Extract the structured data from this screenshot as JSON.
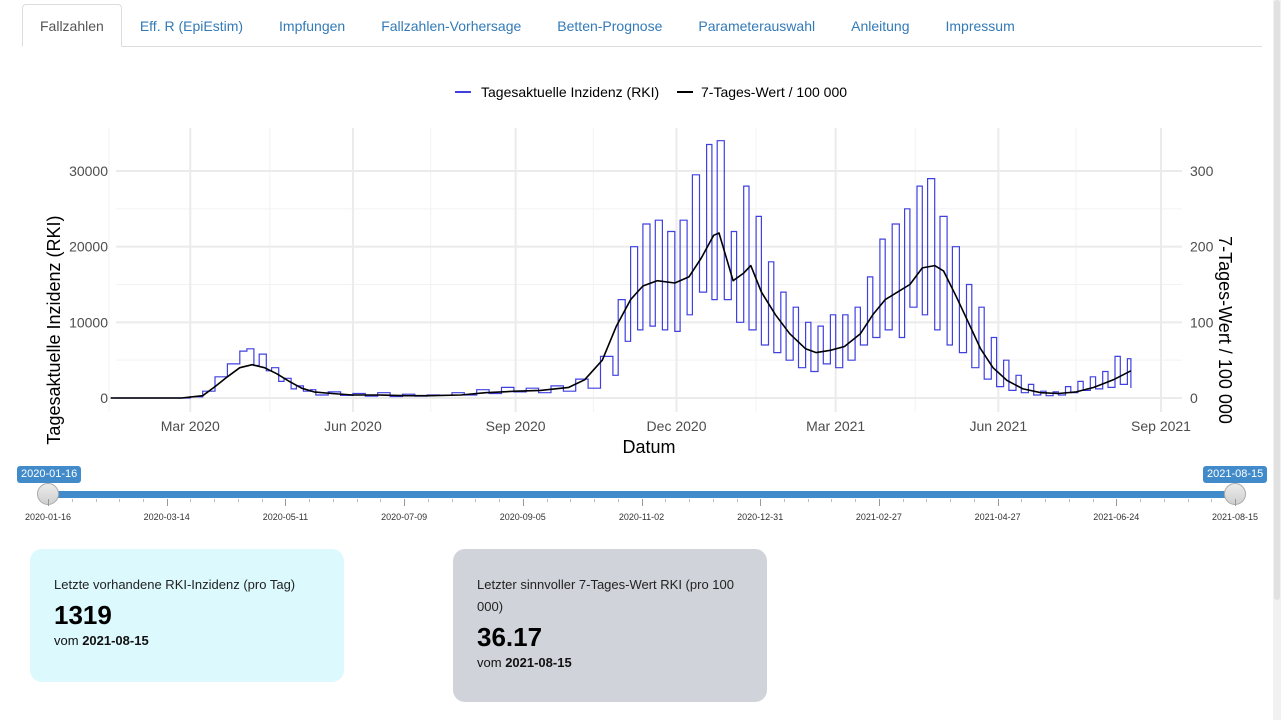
{
  "tabs": [
    {
      "label": "Fallzahlen",
      "active": true
    },
    {
      "label": "Eff. R (EpiEstim)",
      "active": false
    },
    {
      "label": "Impfungen",
      "active": false
    },
    {
      "label": "Fallzahlen-Vorhersage",
      "active": false
    },
    {
      "label": "Betten-Prognose",
      "active": false
    },
    {
      "label": "Parameterauswahl",
      "active": false
    },
    {
      "label": "Anleitung",
      "active": false
    },
    {
      "label": "Impressum",
      "active": false
    }
  ],
  "chart_data": {
    "type": "line",
    "xlabel": "Datum",
    "ylabel": "Tagesaktuelle Inzidenz (RKI)",
    "y2label": "7-Tages-Wert / 100 000",
    "x_range": [
      "2020-01-16",
      "2021-08-15"
    ],
    "ylim": [
      0,
      35000
    ],
    "y2lim": [
      0,
      350
    ],
    "y_ticks": [
      0,
      10000,
      20000,
      30000
    ],
    "y_tick_labels": [
      "0",
      "10000",
      "20000",
      "30000"
    ],
    "y2_ticks": [
      0,
      100,
      200,
      300
    ],
    "y2_tick_labels": [
      "0",
      "100",
      "200",
      "300"
    ],
    "x_ticks": [
      "2020-03-01",
      "2020-06-01",
      "2020-09-01",
      "2020-12-01",
      "2021-03-01",
      "2021-06-01",
      "2021-09-01"
    ],
    "x_tick_labels": [
      "Mar 2020",
      "Jun 2020",
      "Sep 2020",
      "Dec 2020",
      "Mar 2021",
      "Jun 2021",
      "Sep 2021"
    ],
    "grid": true,
    "legend_position": "top",
    "series": [
      {
        "name": "Tagesaktuelle Inzidenz (RKI)",
        "color": "#4040e0",
        "axis": "left",
        "points": [
          [
            "2020-01-16",
            0
          ],
          [
            "2020-02-20",
            0
          ],
          [
            "2020-03-01",
            150
          ],
          [
            "2020-03-08",
            900
          ],
          [
            "2020-03-15",
            2800
          ],
          [
            "2020-03-22",
            4500
          ],
          [
            "2020-03-29",
            6200
          ],
          [
            "2020-04-02",
            6500
          ],
          [
            "2020-04-06",
            4300
          ],
          [
            "2020-04-09",
            5800
          ],
          [
            "2020-04-13",
            3600
          ],
          [
            "2020-04-16",
            4000
          ],
          [
            "2020-04-20",
            2200
          ],
          [
            "2020-04-23",
            2600
          ],
          [
            "2020-04-27",
            1200
          ],
          [
            "2020-04-30",
            1600
          ],
          [
            "2020-05-04",
            900
          ],
          [
            "2020-05-08",
            1100
          ],
          [
            "2020-05-11",
            400
          ],
          [
            "2020-05-18",
            800
          ],
          [
            "2020-05-25",
            350
          ],
          [
            "2020-06-01",
            600
          ],
          [
            "2020-06-08",
            250
          ],
          [
            "2020-06-15",
            700
          ],
          [
            "2020-06-22",
            200
          ],
          [
            "2020-06-29",
            500
          ],
          [
            "2020-07-06",
            250
          ],
          [
            "2020-07-13",
            400
          ],
          [
            "2020-07-20",
            350
          ],
          [
            "2020-07-27",
            700
          ],
          [
            "2020-08-03",
            400
          ],
          [
            "2020-08-10",
            1100
          ],
          [
            "2020-08-17",
            600
          ],
          [
            "2020-08-24",
            1400
          ],
          [
            "2020-08-31",
            800
          ],
          [
            "2020-09-07",
            1300
          ],
          [
            "2020-09-14",
            700
          ],
          [
            "2020-09-21",
            1600
          ],
          [
            "2020-09-28",
            900
          ],
          [
            "2020-10-05",
            2500
          ],
          [
            "2020-10-12",
            1300
          ],
          [
            "2020-10-19",
            5500
          ],
          [
            "2020-10-26",
            3000
          ],
          [
            "2020-10-29",
            13000
          ],
          [
            "2020-11-02",
            7500
          ],
          [
            "2020-11-05",
            20000
          ],
          [
            "2020-11-09",
            9000
          ],
          [
            "2020-11-12",
            23000
          ],
          [
            "2020-11-16",
            9500
          ],
          [
            "2020-11-19",
            23500
          ],
          [
            "2020-11-23",
            9000
          ],
          [
            "2020-11-26",
            22000
          ],
          [
            "2020-11-30",
            8800
          ],
          [
            "2020-12-03",
            23500
          ],
          [
            "2020-12-07",
            11000
          ],
          [
            "2020-12-10",
            29500
          ],
          [
            "2020-12-14",
            14000
          ],
          [
            "2020-12-18",
            33500
          ],
          [
            "2020-12-21",
            13000
          ],
          [
            "2020-12-24",
            34000
          ],
          [
            "2020-12-28",
            13000
          ],
          [
            "2021-01-01",
            22000
          ],
          [
            "2021-01-04",
            10000
          ],
          [
            "2021-01-08",
            28000
          ],
          [
            "2021-01-11",
            9000
          ],
          [
            "2021-01-15",
            24000
          ],
          [
            "2021-01-18",
            7000
          ],
          [
            "2021-01-22",
            18000
          ],
          [
            "2021-01-25",
            6000
          ],
          [
            "2021-01-29",
            14000
          ],
          [
            "2021-02-01",
            5000
          ],
          [
            "2021-02-05",
            12000
          ],
          [
            "2021-02-08",
            4000
          ],
          [
            "2021-02-12",
            10000
          ],
          [
            "2021-02-15",
            3500
          ],
          [
            "2021-02-19",
            9500
          ],
          [
            "2021-02-22",
            4500
          ],
          [
            "2021-02-26",
            11000
          ],
          [
            "2021-03-01",
            4000
          ],
          [
            "2021-03-05",
            11000
          ],
          [
            "2021-03-08",
            5000
          ],
          [
            "2021-03-12",
            12000
          ],
          [
            "2021-03-15",
            7000
          ],
          [
            "2021-03-19",
            16000
          ],
          [
            "2021-03-22",
            8000
          ],
          [
            "2021-03-26",
            21000
          ],
          [
            "2021-03-29",
            9000
          ],
          [
            "2021-04-02",
            23000
          ],
          [
            "2021-04-06",
            8000
          ],
          [
            "2021-04-09",
            25000
          ],
          [
            "2021-04-12",
            12000
          ],
          [
            "2021-04-16",
            28000
          ],
          [
            "2021-04-19",
            11000
          ],
          [
            "2021-04-22",
            29000
          ],
          [
            "2021-04-26",
            9000
          ],
          [
            "2021-04-29",
            24000
          ],
          [
            "2021-05-03",
            7000
          ],
          [
            "2021-05-06",
            20000
          ],
          [
            "2021-05-10",
            6000
          ],
          [
            "2021-05-14",
            15000
          ],
          [
            "2021-05-17",
            4000
          ],
          [
            "2021-05-21",
            12000
          ],
          [
            "2021-05-24",
            2500
          ],
          [
            "2021-05-28",
            8000
          ],
          [
            "2021-05-31",
            1500
          ],
          [
            "2021-06-04",
            5000
          ],
          [
            "2021-06-07",
            1000
          ],
          [
            "2021-06-11",
            3000
          ],
          [
            "2021-06-14",
            700
          ],
          [
            "2021-06-18",
            1800
          ],
          [
            "2021-06-21",
            400
          ],
          [
            "2021-06-25",
            900
          ],
          [
            "2021-06-28",
            300
          ],
          [
            "2021-07-02",
            800
          ],
          [
            "2021-07-05",
            400
          ],
          [
            "2021-07-09",
            1500
          ],
          [
            "2021-07-12",
            700
          ],
          [
            "2021-07-16",
            2200
          ],
          [
            "2021-07-19",
            1000
          ],
          [
            "2021-07-23",
            2800
          ],
          [
            "2021-07-26",
            1200
          ],
          [
            "2021-07-30",
            3500
          ],
          [
            "2021-08-02",
            1400
          ],
          [
            "2021-08-06",
            5500
          ],
          [
            "2021-08-09",
            1800
          ],
          [
            "2021-08-13",
            5200
          ],
          [
            "2021-08-15",
            1319
          ]
        ]
      },
      {
        "name": "7-Tages-Wert / 100 000",
        "color": "#000000",
        "axis": "right",
        "points": [
          [
            "2020-01-16",
            0
          ],
          [
            "2020-02-25",
            0
          ],
          [
            "2020-03-08",
            3
          ],
          [
            "2020-03-15",
            15
          ],
          [
            "2020-03-22",
            28
          ],
          [
            "2020-03-29",
            40
          ],
          [
            "2020-04-05",
            44
          ],
          [
            "2020-04-12",
            40
          ],
          [
            "2020-04-19",
            32
          ],
          [
            "2020-04-26",
            22
          ],
          [
            "2020-05-03",
            13
          ],
          [
            "2020-05-10",
            8
          ],
          [
            "2020-05-20",
            6
          ],
          [
            "2020-06-01",
            4
          ],
          [
            "2020-06-15",
            4
          ],
          [
            "2020-07-01",
            3
          ],
          [
            "2020-07-15",
            3
          ],
          [
            "2020-08-01",
            4
          ],
          [
            "2020-08-15",
            7
          ],
          [
            "2020-09-01",
            9
          ],
          [
            "2020-09-15",
            10
          ],
          [
            "2020-10-01",
            14
          ],
          [
            "2020-10-10",
            24
          ],
          [
            "2020-10-20",
            50
          ],
          [
            "2020-10-28",
            95
          ],
          [
            "2020-11-05",
            130
          ],
          [
            "2020-11-12",
            148
          ],
          [
            "2020-11-20",
            155
          ],
          [
            "2020-11-30",
            152
          ],
          [
            "2020-12-08",
            160
          ],
          [
            "2020-12-15",
            185
          ],
          [
            "2020-12-22",
            215
          ],
          [
            "2020-12-25",
            218
          ],
          [
            "2021-01-02",
            155
          ],
          [
            "2021-01-08",
            165
          ],
          [
            "2021-01-12",
            175
          ],
          [
            "2021-01-18",
            140
          ],
          [
            "2021-01-26",
            110
          ],
          [
            "2021-02-03",
            85
          ],
          [
            "2021-02-12",
            65
          ],
          [
            "2021-02-18",
            60
          ],
          [
            "2021-02-26",
            63
          ],
          [
            "2021-03-06",
            68
          ],
          [
            "2021-03-15",
            85
          ],
          [
            "2021-03-22",
            110
          ],
          [
            "2021-03-29",
            130
          ],
          [
            "2021-04-05",
            140
          ],
          [
            "2021-04-12",
            150
          ],
          [
            "2021-04-19",
            172
          ],
          [
            "2021-04-26",
            175
          ],
          [
            "2021-05-01",
            168
          ],
          [
            "2021-05-08",
            135
          ],
          [
            "2021-05-15",
            100
          ],
          [
            "2021-05-22",
            65
          ],
          [
            "2021-05-29",
            40
          ],
          [
            "2021-06-06",
            23
          ],
          [
            "2021-06-15",
            12
          ],
          [
            "2021-06-25",
            7
          ],
          [
            "2021-07-05",
            6
          ],
          [
            "2021-07-15",
            8
          ],
          [
            "2021-07-25",
            14
          ],
          [
            "2021-08-05",
            24
          ],
          [
            "2021-08-15",
            36
          ]
        ]
      }
    ]
  },
  "slider": {
    "min_label": "2020-01-16",
    "max_label": "2021-08-15",
    "ticks": [
      "2020-01-16",
      "2020-03-14",
      "2020-05-11",
      "2020-07-09",
      "2020-09-05",
      "2020-11-02",
      "2020-12-31",
      "2021-02-27",
      "2021-04-27",
      "2021-06-24",
      "2021-08-15"
    ]
  },
  "boxes": {
    "rki": {
      "title": "Letzte vorhandene RKI-Inzidenz (pro Tag)",
      "value": "1319",
      "date_prefix": "vom",
      "date": "2021-08-15"
    },
    "seven_day": {
      "title": "Letzter sinnvoller 7-Tages-Wert RKI (pro 100 000)",
      "value": "36.17",
      "date_prefix": "vom",
      "date": "2021-08-15"
    }
  }
}
